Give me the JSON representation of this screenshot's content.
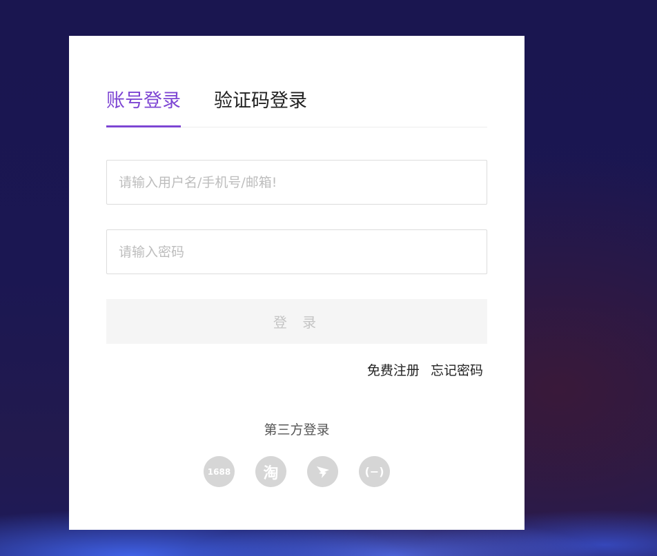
{
  "login": {
    "tabs": [
      {
        "label": "账号登录",
        "active": true
      },
      {
        "label": "验证码登录",
        "active": false
      }
    ],
    "username": {
      "placeholder": "请输入用户名/手机号/邮箱!",
      "value": ""
    },
    "password": {
      "placeholder": "请输入密码",
      "value": ""
    },
    "submit_label": "登 录",
    "register_link": "免费注册",
    "forgot_link": "忘记密码",
    "third_party_title": "第三方登录",
    "third_party": [
      {
        "name": "1688",
        "icon": "1688-icon",
        "text": "1688"
      },
      {
        "name": "taobao",
        "icon": "taobao-icon",
        "text": "淘"
      },
      {
        "name": "dingtalk",
        "icon": "dingtalk-icon",
        "text": ""
      },
      {
        "name": "alibaba",
        "icon": "alibaba-icon",
        "text": "(−)"
      }
    ]
  },
  "colors": {
    "accent": "#7d45d3",
    "button_bg": "#f5f5f5",
    "icon_bg": "#d6d6d6"
  }
}
